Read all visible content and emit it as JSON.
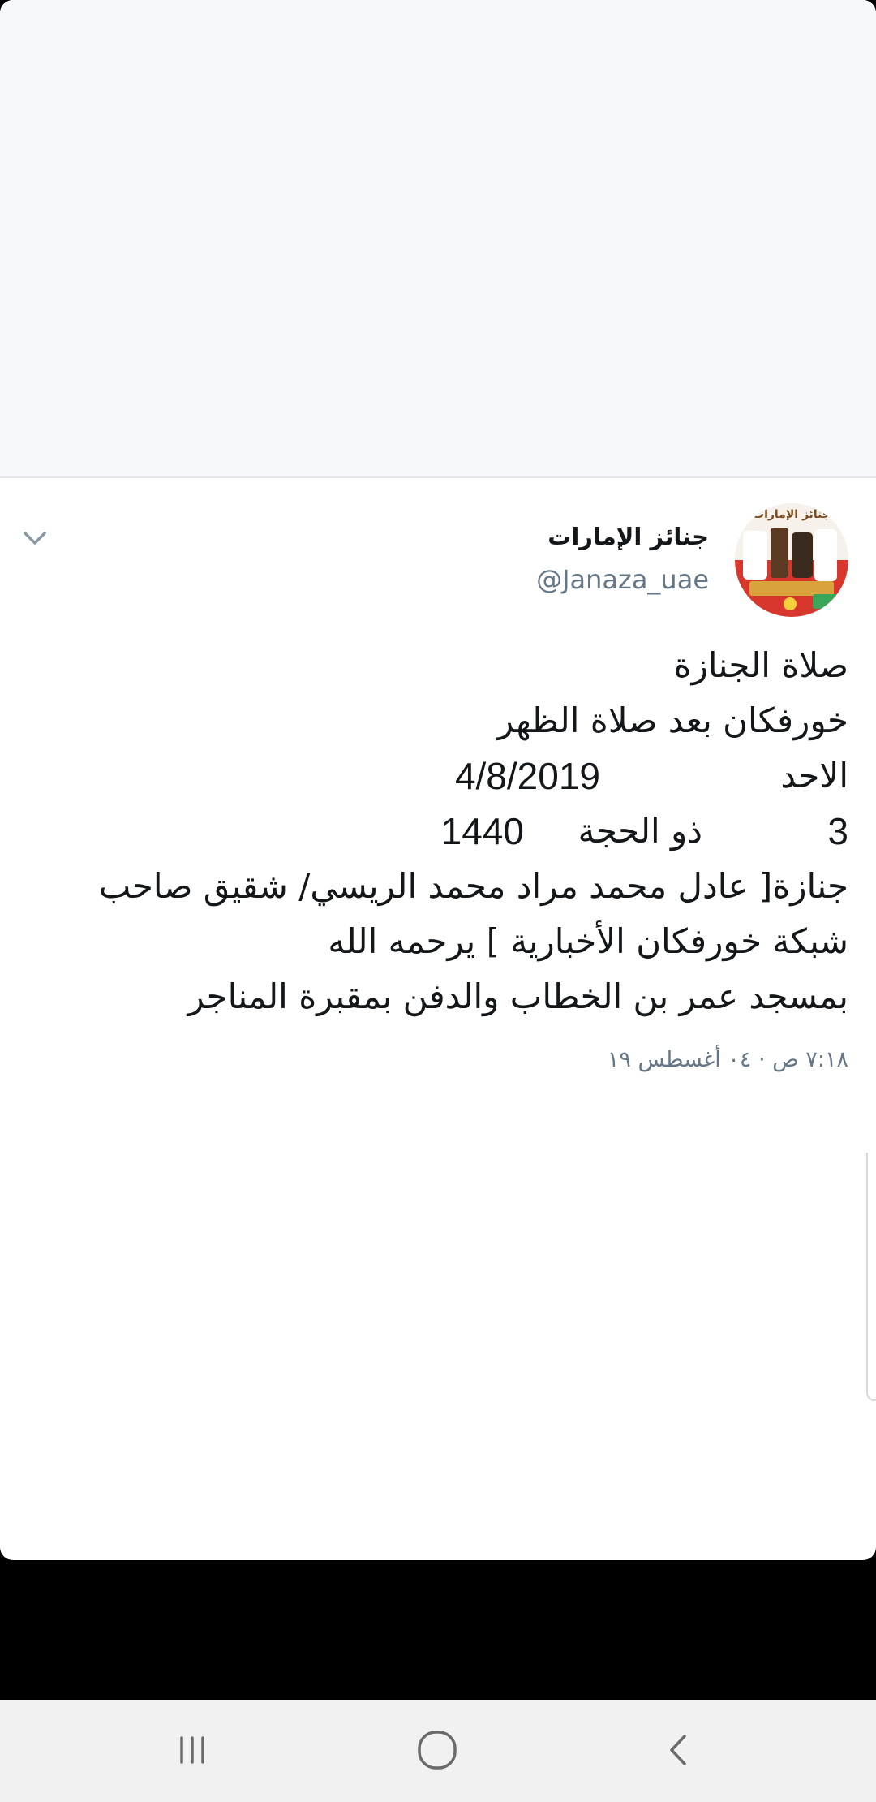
{
  "tweet": {
    "user_name": "جنائز الإمارات",
    "handle": "@Janaza_uae",
    "avatar_title": "جنائز الإمارات",
    "lines": {
      "l1": "صلاة الجنازة",
      "l2": "خورفكان بعد صلاة الظهر",
      "l3_day": "الاحد",
      "l3_date": "4/8/2019",
      "l4_day": "3",
      "l4_month": "ذو الحجة",
      "l4_year": "1440",
      "l5": "جنازة[  عادل محمد مراد محمد الريسي/ شقيق صاحب",
      "l6": "شبكة خورفكان الأخبارية  ]  يرحمه الله",
      "l7": "بمسجد عمر بن الخطاب والدفن بمقبرة المناجر"
    },
    "timestamp": "٧:١٨ ص · ٠٤ أغسطس ١٩"
  },
  "icons": {
    "more": "chevron-down-icon",
    "nav_recents": "recents-icon",
    "nav_home": "home-icon",
    "nav_back": "back-icon"
  },
  "colors": {
    "text": "#14171a",
    "secondary": "#657786",
    "nav_bg": "#f1f1f1"
  }
}
